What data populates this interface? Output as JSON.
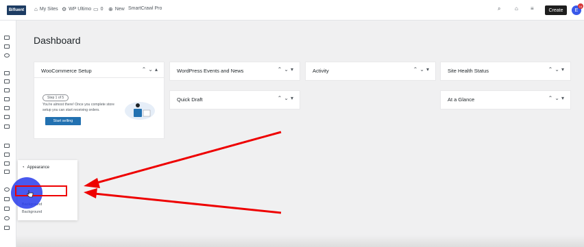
{
  "topbar": {
    "site_name": "My Sites",
    "plugin": "WP Ultimo",
    "comment_count": "0",
    "new_label": "New",
    "theme": "SmartCrawl Pro",
    "create_label": "Create",
    "avatar_initial": "E",
    "notification_count": "14",
    "logo_text": "Bifluent"
  },
  "page": {
    "title": "Dashboard"
  },
  "widgets": {
    "woocommerce": {
      "title": "WooCommerce Setup",
      "step": "Step 1 of 5",
      "text": "You're almost there! Once you complete store setup you can start receiving orders.",
      "button": "Start selling"
    },
    "events": {
      "title": "WordPress Events and News"
    },
    "activity": {
      "title": "Activity"
    },
    "site_health": {
      "title": "Site Health Status"
    },
    "quick_draft": {
      "title": "Quick Draft"
    },
    "at_a_glance": {
      "title": "At a Glance"
    }
  },
  "appearance_menu": {
    "title": "Appearance",
    "items": [
      "Background",
      "Background"
    ]
  },
  "colors": {
    "accent": "#2271b1",
    "highlight": "#3858e9",
    "annotation": "#e00000"
  }
}
